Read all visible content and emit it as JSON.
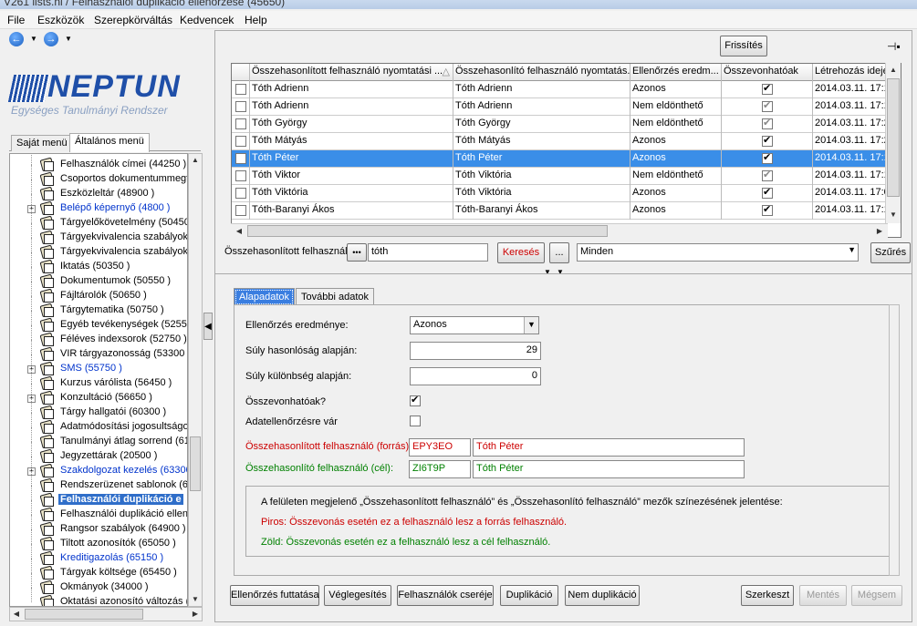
{
  "window": {
    "title": "V261 lists.nl / Felhasználói duplikáció ellenőrzése (45650)"
  },
  "menu": [
    "File",
    "Eszközök",
    "Szerepkörváltás",
    "Kedvencek",
    "Help"
  ],
  "logo": {
    "name": "NEPTUN",
    "subtitle": "Egységes Tanulmányi Rendszer"
  },
  "left_tabs": {
    "own": "Saját menü",
    "general": "Általános menü"
  },
  "tree": [
    {
      "label": "Felhasználók címei (44250 )",
      "type": "leaf"
    },
    {
      "label": "Csoportos dokumentummegte",
      "type": "leaf"
    },
    {
      "label": "Eszközleltár (48900 )",
      "type": "leaf"
    },
    {
      "label": "Belépő képernyő (4800 )",
      "type": "node",
      "color": "blue"
    },
    {
      "label": "Tárgyelőkövetelmény (50450",
      "type": "leaf"
    },
    {
      "label": "Tárgyekvivalencia szabályok",
      "type": "leaf"
    },
    {
      "label": "Tárgyekvivalencia szabályok",
      "type": "leaf"
    },
    {
      "label": "Iktatás (50350 )",
      "type": "leaf"
    },
    {
      "label": "Dokumentumok (50550 )",
      "type": "leaf"
    },
    {
      "label": "Fájltárolók (50650 )",
      "type": "leaf"
    },
    {
      "label": "Tárgytematika (50750 )",
      "type": "leaf"
    },
    {
      "label": "Egyéb tevékenységek (52550",
      "type": "leaf"
    },
    {
      "label": "Féléves indexsorok (52750 )",
      "type": "leaf"
    },
    {
      "label": "VIR tárgyazonosság (53300 )",
      "type": "leaf"
    },
    {
      "label": "SMS (55750 )",
      "type": "node",
      "color": "blue"
    },
    {
      "label": "Kurzus várólista (56450 )",
      "type": "leaf"
    },
    {
      "label": "Konzultáció (56650 )",
      "type": "node"
    },
    {
      "label": "Tárgy hallgatói (60300 )",
      "type": "leaf"
    },
    {
      "label": "Adatmódosítási jogosultságok",
      "type": "leaf"
    },
    {
      "label": "Tanulmányi átlag sorrend (613",
      "type": "leaf"
    },
    {
      "label": "Jegyzettárak (20500 )",
      "type": "leaf"
    },
    {
      "label": "Szakdolgozat kezelés (63300",
      "type": "node",
      "color": "blue"
    },
    {
      "label": "Rendszerüzenet sablonok (64",
      "type": "leaf"
    },
    {
      "label": "Felhasználói duplikáció e",
      "type": "leaf",
      "selected": true
    },
    {
      "label": "Felhasználói duplikáció ellenő",
      "type": "leaf"
    },
    {
      "label": "Rangsor szabályok (64900 )",
      "type": "leaf"
    },
    {
      "label": "Tiltott azonosítók (65050 )",
      "type": "leaf"
    },
    {
      "label": "Kreditigazolás (65150 )",
      "type": "leaf",
      "color": "blue"
    },
    {
      "label": "Tárgyak költsége (65450 )",
      "type": "leaf"
    },
    {
      "label": "Okmányok (34000 )",
      "type": "leaf"
    },
    {
      "label": "Oktatási azonosító változás (",
      "type": "leaf"
    }
  ],
  "toolbar": {
    "refresh": "Frissítés"
  },
  "grid": {
    "columns": [
      "Összehasonlított felhasználó nyomtatási ...",
      "Összehasonlító felhasználó nyomtatás...",
      "Ellenőrzés eredm...",
      "Összevonhatóak",
      "Létrehozás ideje"
    ],
    "rows": [
      {
        "a": "Tóth Adrienn",
        "b": "Tóth Adrienn",
        "result": "Azonos",
        "mergeable": "on",
        "created": "2014.03.11. 17:1"
      },
      {
        "a": "Tóth Adrienn",
        "b": "Tóth Adrienn",
        "result": "Nem eldönthető",
        "mergeable": "gray",
        "created": "2014.03.11. 17:1"
      },
      {
        "a": "Tóth György",
        "b": "Tóth György",
        "result": "Nem eldönthető",
        "mergeable": "gray",
        "created": "2014.03.11. 17:2"
      },
      {
        "a": "Tóth Mátyás",
        "b": "Tóth Mátyás",
        "result": "Azonos",
        "mergeable": "on",
        "created": "2014.03.11. 17:2"
      },
      {
        "a": "Tóth Péter",
        "b": "Tóth Péter",
        "result": "Azonos",
        "mergeable": "on",
        "created": "2014.03.11. 17:1",
        "selected": true
      },
      {
        "a": "Tóth Viktor",
        "b": "Tóth Viktória",
        "result": "Nem eldönthető",
        "mergeable": "gray",
        "created": "2014.03.11. 17:1"
      },
      {
        "a": "Tóth Viktória",
        "b": "Tóth Viktória",
        "result": "Azonos",
        "mergeable": "on",
        "created": "2014.03.11. 17:0"
      },
      {
        "a": "Tóth-Baranyi Ákos",
        "b": "Tóth-Baranyi Ákos",
        "result": "Azonos",
        "mergeable": "on",
        "created": "2014.03.11. 17:1"
      }
    ]
  },
  "filter": {
    "label": "Összehasonlított felhasznál",
    "dots": "•••",
    "value": "tóth",
    "search": "Keresés",
    "more": "...",
    "select": "Minden",
    "apply": "Szűrés"
  },
  "detail_tabs": {
    "basic": "Alapadatok",
    "more": "További adatok"
  },
  "form": {
    "result_label": "Ellenőrzés eredménye:",
    "result_value": "Azonos",
    "sim_label": "Súly hasonlóság alapján:",
    "sim_value": "29",
    "diff_label": "Súly különbség alapján:",
    "diff_value": "0",
    "mergeable_label": "Összevonhatóak?",
    "pending_label": "Adatellenőrzésre vár",
    "source_label": "Összehasonlított felhasználó (forrás):",
    "source_code": "EPY3EO",
    "source_name": "Tóth Péter",
    "target_label": "Összehasonlító felhasználó (cél):",
    "target_code": "ZI6T9P",
    "target_name": "Tóth Péter",
    "info1": "A felületen megjelenő „Összehasonlított felhasználó” és „Összehasonlító felhasználó” mezők színezésének jelentése:",
    "info2": "Piros: Összevonás esetén ez a felhasználó lesz a forrás felhasználó.",
    "info3": "Zöld: Összevonás esetén ez a felhasználó lesz a cél felhasználó."
  },
  "actions": {
    "run": "Ellenőrzés futtatása",
    "finalize": "Véglegesítés",
    "swap": "Felhasználók cseréje",
    "dup": "Duplikáció",
    "notdup": "Nem duplikáció",
    "edit": "Szerkeszt",
    "save": "Mentés",
    "cancel": "Mégsem"
  },
  "colors": {
    "selection": "#3a8ee8",
    "source": "#cc0000",
    "target": "#008000",
    "brand": "#1f4fa8"
  }
}
